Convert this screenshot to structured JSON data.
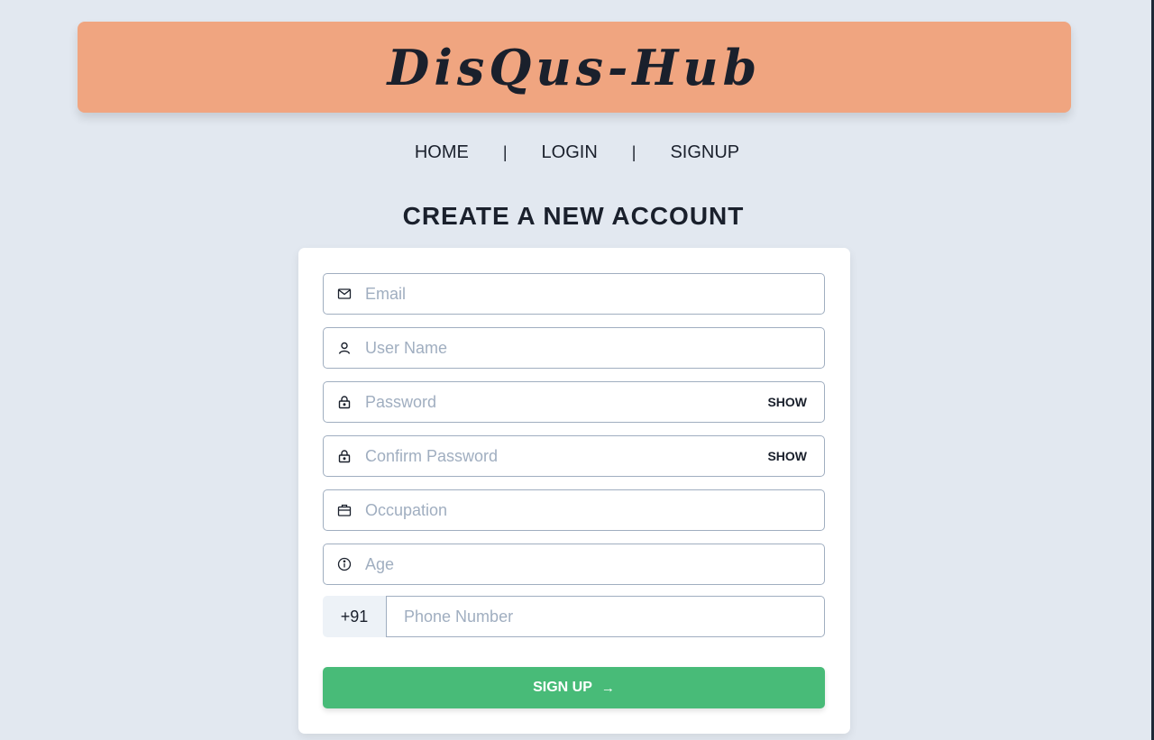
{
  "app": {
    "title": "DisQus-Hub"
  },
  "nav": {
    "items": [
      {
        "label": "HOME"
      },
      {
        "label": "LOGIN"
      },
      {
        "label": "SIGNUP"
      }
    ],
    "separator": "|"
  },
  "form": {
    "heading": "CREATE A NEW ACCOUNT",
    "fields": {
      "email": {
        "placeholder": "Email",
        "icon": "mail-icon"
      },
      "username": {
        "placeholder": "User Name",
        "icon": "user-icon"
      },
      "password": {
        "placeholder": "Password",
        "icon": "lock-icon",
        "toggle_label": "SHOW"
      },
      "confirm_password": {
        "placeholder": "Confirm Password",
        "icon": "lock-icon",
        "toggle_label": "SHOW"
      },
      "occupation": {
        "placeholder": "Occupation",
        "icon": "briefcase-icon"
      },
      "age": {
        "placeholder": "Age",
        "icon": "info-icon"
      },
      "phone": {
        "prefix": "+91",
        "placeholder": "Phone Number"
      }
    },
    "submit": {
      "label": "SIGN UP",
      "icon": "arrow-right-icon",
      "arrow_glyph": "→"
    }
  },
  "colors": {
    "banner": "#f0a580",
    "background": "#e2e8f0",
    "submit": "#48bb78",
    "placeholder": "#a0aec0"
  }
}
